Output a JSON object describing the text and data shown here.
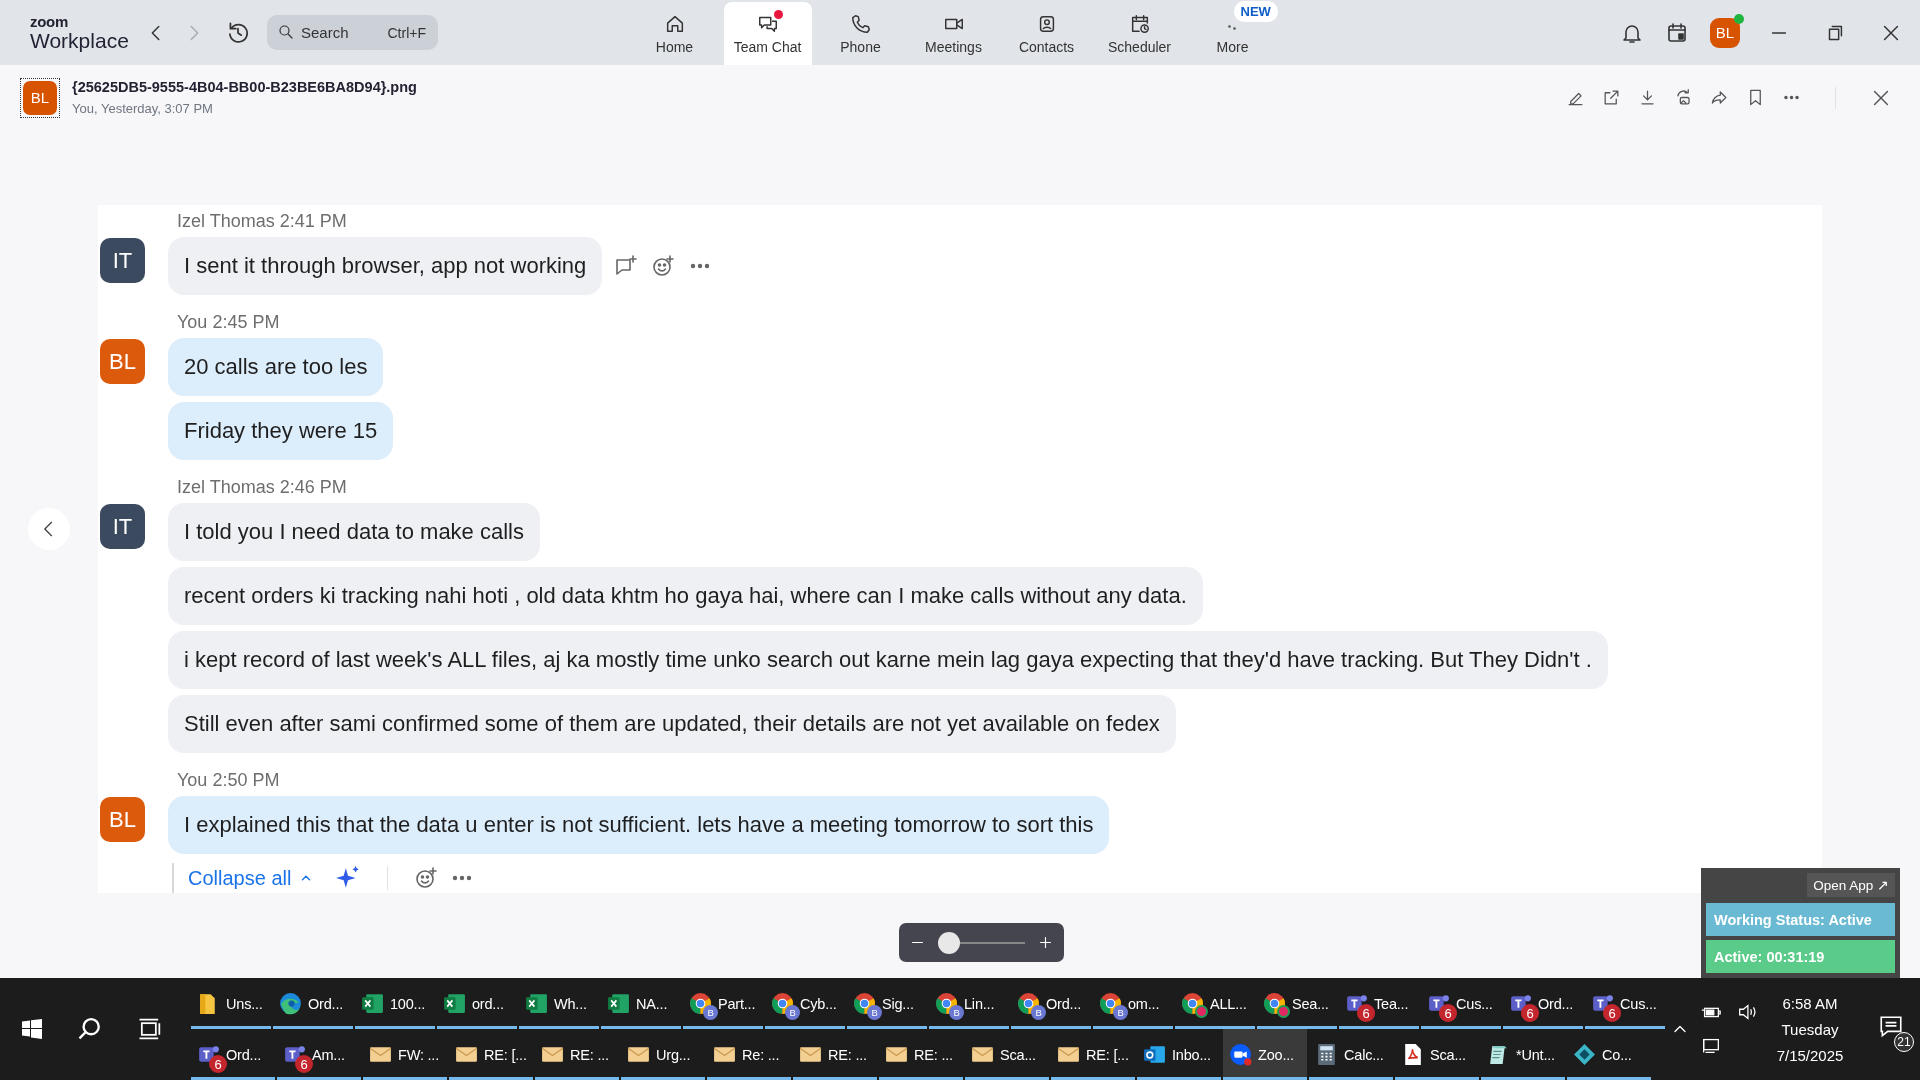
{
  "app": {
    "logo_small": "zoom",
    "logo_name": "Workplace"
  },
  "search": {
    "placeholder": "Search",
    "shortcut": "Ctrl+F"
  },
  "tabs": [
    {
      "label": "Home",
      "selected": false,
      "unread": false
    },
    {
      "label": "Team Chat",
      "selected": true,
      "unread": true
    },
    {
      "label": "Phone",
      "selected": false,
      "unread": false
    },
    {
      "label": "Meetings",
      "selected": false,
      "unread": false
    },
    {
      "label": "Contacts",
      "selected": false,
      "unread": false
    },
    {
      "label": "Scheduler",
      "selected": false,
      "unread": false
    },
    {
      "label": "More",
      "selected": false,
      "unread": false,
      "badge": "NEW"
    }
  ],
  "profile": {
    "initials": "BL",
    "online": true
  },
  "file": {
    "avatar": "BL",
    "name": "{25625DB5-9555-4B04-BB00-B23BE6BA8D94}.png",
    "meta": "You, Yesterday, 3:07 PM"
  },
  "chat": {
    "groups": [
      {
        "sender": "Izel Thomas",
        "time": "2:41 PM",
        "initials": "IT",
        "kind": "other",
        "messages": [
          "I sent it through browser, app not working"
        ]
      },
      {
        "sender": "You",
        "time": "2:45 PM",
        "initials": "BL",
        "kind": "self",
        "messages": [
          "20 calls are too les",
          "Friday they were 15"
        ]
      },
      {
        "sender": "Izel Thomas",
        "time": "2:46 PM",
        "initials": "IT",
        "kind": "other",
        "messages": [
          "I told you I need data to make calls",
          "recent orders ki tracking nahi hoti , old data khtm ho gaya hai, where can I make calls without any data.",
          "i kept record of last week's ALL files, aj ka mostly time unko search out karne mein lag gaya expecting that they'd have tracking. But They Didn't .",
          "Still even after sami confirmed some of them are updated, their details are not yet available on fedex"
        ]
      },
      {
        "sender": "You",
        "time": "2:50 PM",
        "initials": "BL",
        "kind": "self",
        "messages": [
          "I explained this that the data u enter is not sufficient. lets have a meeting tomorrow to sort this"
        ]
      }
    ],
    "collapse_label": "Collapse all"
  },
  "zoom_slider": {
    "level": 0.0
  },
  "widget": {
    "open_app": "Open App ↗",
    "status": "Working Status: Active",
    "timer": "Active: 00:31:19"
  },
  "taskbar": {
    "top_row": [
      {
        "label": "Uns...",
        "kind": "folder",
        "selected": false
      },
      {
        "label": "Ord...",
        "kind": "edge",
        "selected": false
      },
      {
        "label": "100...",
        "kind": "excel",
        "selected": false
      },
      {
        "label": "ord...",
        "kind": "excel",
        "selected": false
      },
      {
        "label": "Wh...",
        "kind": "excel",
        "selected": false
      },
      {
        "label": "NA...",
        "kind": "excel",
        "selected": false
      },
      {
        "label": "Part...",
        "kind": "chrome",
        "profile": "B",
        "selected": false
      },
      {
        "label": "Cyb...",
        "kind": "chrome",
        "profile": "B",
        "selected": false
      },
      {
        "label": "Sig...",
        "kind": "chrome",
        "profile": "B",
        "selected": false
      },
      {
        "label": "Lin...",
        "kind": "chrome",
        "profile": "B",
        "selected": false
      },
      {
        "label": "Ord...",
        "kind": "chrome",
        "profile": "B",
        "selected": false
      },
      {
        "label": "om...",
        "kind": "chrome",
        "profile": "B",
        "selected": false
      },
      {
        "label": "ALL...",
        "kind": "chrome-dot",
        "selected": false
      },
      {
        "label": "Sea...",
        "kind": "chrome-dot",
        "selected": false
      },
      {
        "label": "Tea...",
        "kind": "teams",
        "count": "6",
        "selected": false
      },
      {
        "label": "Cus...",
        "kind": "teams",
        "count": "6",
        "selected": false
      },
      {
        "label": "Ord...",
        "kind": "teams",
        "count": "6",
        "selected": false
      },
      {
        "label": "Cus...",
        "kind": "teams",
        "count": "6",
        "selected": false
      }
    ],
    "bottom_row": [
      {
        "label": "Ord...",
        "kind": "teams",
        "count": "6",
        "selected": false
      },
      {
        "label": "Am...",
        "kind": "teams",
        "count": "6",
        "selected": false
      },
      {
        "label": "FW: ...",
        "kind": "mail",
        "selected": false
      },
      {
        "label": "RE: [...",
        "kind": "mail",
        "selected": false
      },
      {
        "label": "RE: ...",
        "kind": "mail",
        "selected": false
      },
      {
        "label": "Urg...",
        "kind": "mail",
        "selected": false
      },
      {
        "label": "Re: ...",
        "kind": "mail",
        "selected": false
      },
      {
        "label": "RE: ...",
        "kind": "mail",
        "selected": false
      },
      {
        "label": "RE: ...",
        "kind": "mail",
        "selected": false
      },
      {
        "label": "Sca...",
        "kind": "mail",
        "selected": false
      },
      {
        "label": "RE: [...",
        "kind": "mail",
        "selected": false
      },
      {
        "label": "Inbo...",
        "kind": "outlook",
        "selected": false
      },
      {
        "label": "Zoo...",
        "kind": "zoom",
        "selected": true
      },
      {
        "label": "Calc...",
        "kind": "calc",
        "selected": false
      },
      {
        "label": "Sca...",
        "kind": "pdf",
        "selected": false
      },
      {
        "label": "*Unt...",
        "kind": "notepad",
        "selected": false
      },
      {
        "label": "Co...",
        "kind": "diamond",
        "selected": false
      }
    ]
  },
  "clock": {
    "time": "6:58 AM",
    "day": "Tuesday",
    "date": "7/15/2025"
  },
  "notifications": {
    "count": "21"
  }
}
